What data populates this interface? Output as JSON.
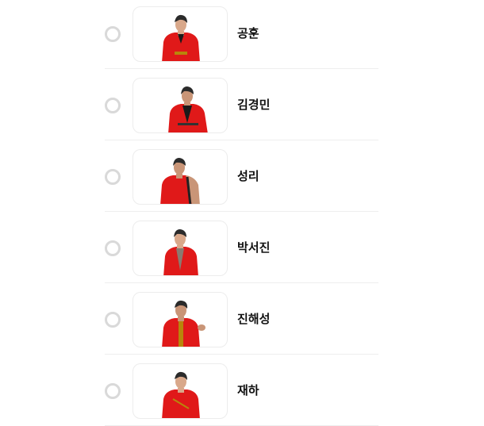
{
  "candidates": [
    {
      "name": "공훈",
      "selected": false,
      "photo_icon": "person-photo-icon",
      "outfit_color": "#e01919"
    },
    {
      "name": "김경민",
      "selected": false,
      "photo_icon": "person-photo-icon",
      "outfit_color": "#e01919"
    },
    {
      "name": "성리",
      "selected": false,
      "photo_icon": "person-photo-icon",
      "outfit_color": "#e01919"
    },
    {
      "name": "박서진",
      "selected": false,
      "photo_icon": "person-photo-icon",
      "outfit_color": "#e01919"
    },
    {
      "name": "진해성",
      "selected": false,
      "photo_icon": "person-photo-icon",
      "outfit_color": "#e01919"
    },
    {
      "name": "재하",
      "selected": false,
      "photo_icon": "person-photo-icon",
      "outfit_color": "#e01919"
    }
  ],
  "colors": {
    "radio_border": "#d9d9d9",
    "divider": "#eeeeee",
    "text": "#111111"
  }
}
